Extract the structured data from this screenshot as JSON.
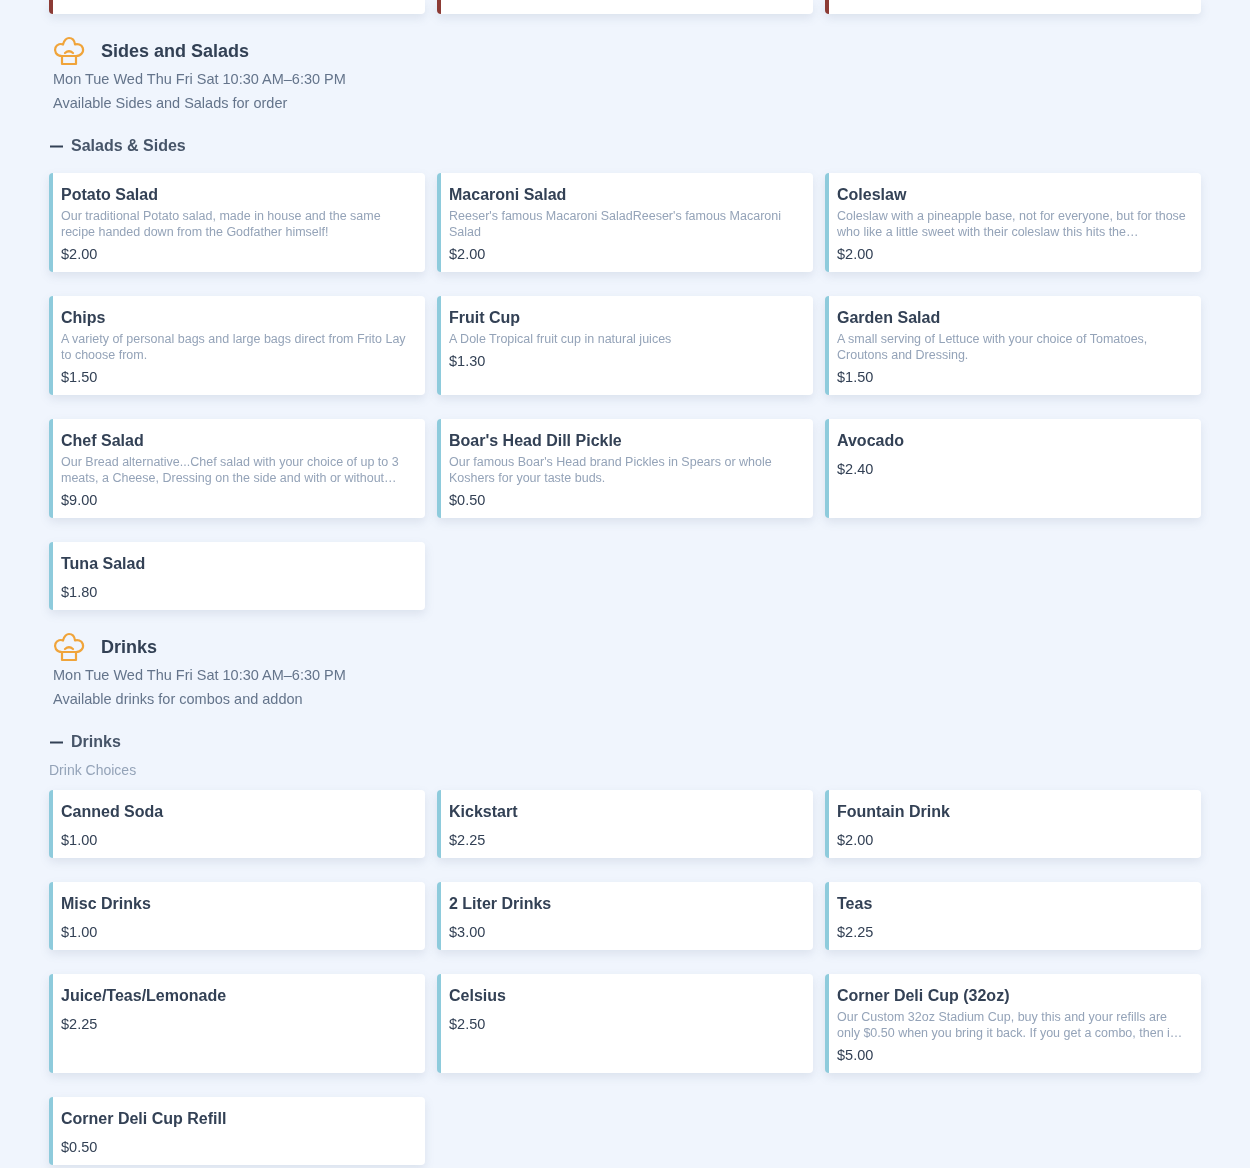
{
  "previous_section": {
    "color": "#8c3b35",
    "cards": [
      {
        "kind": "cut-off"
      },
      {
        "kind": "cut-off"
      },
      {
        "kind": "cut-off"
      }
    ]
  },
  "sections": [
    {
      "title": "Sides and Salads",
      "hours": "Mon Tue Wed Thu Fri Sat 10:30 AM–6:30 PM",
      "description": "Available Sides and Salads for order",
      "color": "#8ecbdc",
      "categories": [
        {
          "title": "Salads & Sides",
          "expanded": true,
          "items": [
            {
              "name": "Potato Salad",
              "description": "Our traditional Potato salad, made in house and the same recipe handed down from the Godfather himself!",
              "price": "$2.00"
            },
            {
              "name": "Macaroni Salad",
              "description": "Reeser's famous Macaroni SaladReeser's famous Macaroni Salad",
              "price": "$2.00"
            },
            {
              "name": "Coleslaw",
              "description": "Coleslaw with a pineapple base, not for everyone, but for those who like a little sweet with their coleslaw this hits the…",
              "price": "$2.00"
            },
            {
              "name": "Chips",
              "description": "A variety of personal bags and large bags direct from Frito Lay to choose from.",
              "price": "$1.50"
            },
            {
              "name": "Fruit Cup",
              "description": "A Dole Tropical fruit cup in natural juices",
              "price": "$1.30"
            },
            {
              "name": "Garden Salad",
              "description": "A small serving of Lettuce with your choice of Tomatoes, Croutons and Dressing.",
              "price": "$1.50"
            },
            {
              "name": "Chef Salad",
              "description": "Our Bread alternative...Chef salad with your choice of up to 3 meats, a Cheese, Dressing on the side and with or without…",
              "price": "$9.00"
            },
            {
              "name": "Boar's Head Dill Pickle",
              "description": "Our famous Boar's Head brand Pickles in Spears or whole Koshers for your taste buds.",
              "price": "$0.50"
            },
            {
              "name": "Avocado",
              "price": "$2.40"
            },
            {
              "name": "Tuna Salad",
              "price": "$1.80"
            }
          ]
        }
      ]
    },
    {
      "title": "Drinks",
      "hours": "Mon Tue Wed Thu Fri Sat 10:30 AM–6:30 PM",
      "description": "Available drinks for combos and addon",
      "color": "#8ecbdc",
      "categories": [
        {
          "title": "Drinks",
          "expanded": true,
          "subtitle": "Drink Choices",
          "items": [
            {
              "name": "Canned Soda",
              "price": "$1.00"
            },
            {
              "name": "Kickstart",
              "price": "$2.25"
            },
            {
              "name": "Fountain Drink",
              "price": "$2.00"
            },
            {
              "name": "Misc Drinks",
              "price": "$1.00"
            },
            {
              "name": "2 Liter Drinks",
              "price": "$3.00"
            },
            {
              "name": "Teas",
              "price": "$2.25"
            },
            {
              "name": "Juice/Teas/Lemonade",
              "price": "$2.25"
            },
            {
              "name": "Celsius",
              "price": "$2.50"
            },
            {
              "name": "Corner Deli Cup (32oz)",
              "description": "Our Custom 32oz Stadium Cup, buy this and your refills are only $0.50 when you bring it back. If you get a combo, then i…",
              "price": "$5.00"
            },
            {
              "name": "Corner Deli Cup Refill",
              "price": "$0.50"
            }
          ]
        }
      ]
    }
  ]
}
